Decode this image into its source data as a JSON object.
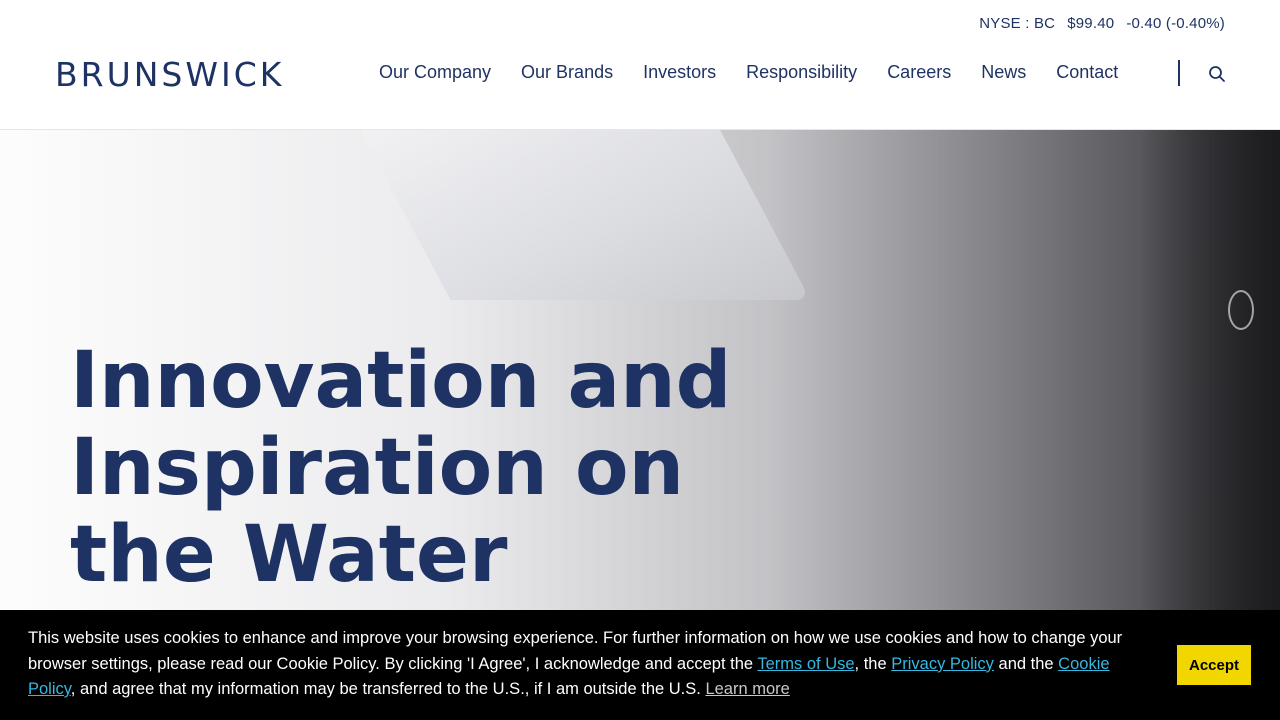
{
  "header": {
    "logo": "BRUNSWICK",
    "ticker": {
      "exchange": "NYSE : BC",
      "price": "$99.40",
      "change": "-0.40 (-0.40%)"
    },
    "nav": [
      "Our Company",
      "Our Brands",
      "Investors",
      "Responsibility",
      "Careers",
      "News",
      "Contact"
    ],
    "search_icon": "search-icon"
  },
  "hero": {
    "title": "Innovation and Inspiration on the Water"
  },
  "cookie": {
    "text_1": "This website uses cookies to enhance and improve your browsing experience. For further information on how we use cookies and how to change your browser settings, please read our Cookie Policy. By clicking 'I Agree', I acknowledge and accept the ",
    "terms_link": "Terms of Use",
    "text_2": ", the ",
    "privacy_link": "Privacy Policy",
    "text_3": " and the ",
    "cookie_link": "Cookie Policy",
    "text_4": ", and agree that my information may be transferred to the U.S., if I am outside the U.S. ",
    "learn_more": "Learn more",
    "accept_label": "Accept"
  },
  "colors": {
    "brand_navy": "#1e3364",
    "accept_yellow": "#f1d600",
    "link_cyan": "#35b7e0"
  }
}
